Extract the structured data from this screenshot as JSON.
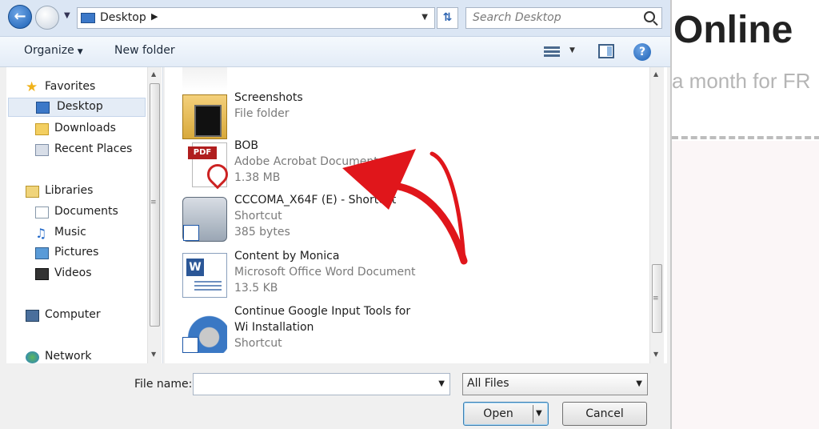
{
  "background_page": {
    "heading": "Online",
    "subtext": "a month for FR"
  },
  "address_bar": {
    "location": "Desktop",
    "search_placeholder": "Search Desktop"
  },
  "toolbar": {
    "organize": "Organize",
    "new_folder": "New folder",
    "help": "?"
  },
  "nav_pane": {
    "items": [
      {
        "label": "Favorites",
        "icon": "star-icon"
      },
      {
        "label": "Desktop",
        "icon": "desktop-icon",
        "selected": true
      },
      {
        "label": "Downloads",
        "icon": "downloads-folder-icon"
      },
      {
        "label": "Recent Places",
        "icon": "recent-places-icon"
      },
      {
        "label": "Libraries",
        "icon": "libraries-icon"
      },
      {
        "label": "Documents",
        "icon": "documents-icon"
      },
      {
        "label": "Music",
        "icon": "music-icon"
      },
      {
        "label": "Pictures",
        "icon": "pictures-icon"
      },
      {
        "label": "Videos",
        "icon": "videos-icon"
      },
      {
        "label": "Computer",
        "icon": "computer-icon"
      },
      {
        "label": "Network",
        "icon": "network-icon"
      }
    ]
  },
  "files": [
    {
      "name": "Screenshots",
      "type": "File folder",
      "size": "",
      "icon": "folder-icon"
    },
    {
      "name": "BOB",
      "type": "Adobe Acrobat Document",
      "size": "1.38 MB",
      "icon": "pdf-icon"
    },
    {
      "name": "CCCOMA_X64F (E) - Shortcut",
      "type": "Shortcut",
      "size": "385 bytes",
      "icon": "drive-shortcut-icon"
    },
    {
      "name": "Content by Monica",
      "type": "Microsoft Office Word Document",
      "size": "13.5 KB",
      "icon": "word-document-icon"
    },
    {
      "name": "Continue Google Input Tools for",
      "name_line2": "Wi Installation",
      "type": "Shortcut",
      "size": "",
      "icon": "installer-shortcut-icon"
    }
  ],
  "bottom": {
    "file_name_label": "File name:",
    "file_name_value": "",
    "filter": "All Files",
    "open": "Open",
    "cancel": "Cancel"
  },
  "colors": {
    "annotation_arrow": "#e0161b",
    "toolbar_bg": "#e3ecf7",
    "selected_nav": "#e4ecf6"
  }
}
